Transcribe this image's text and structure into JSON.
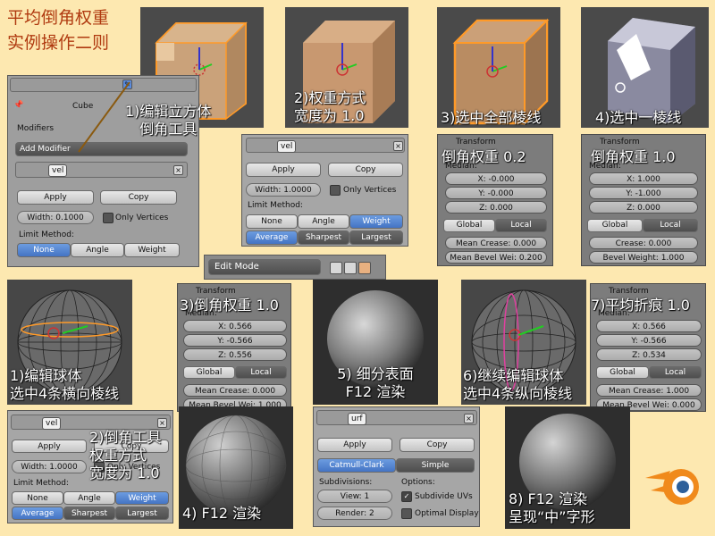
{
  "title": {
    "line1": "平均倒角权重",
    "line2": "实例操作二则"
  },
  "captions": {
    "c1": "1)编辑立方体",
    "c1b": "倒角工具",
    "c2": "2)权重方式",
    "c2b": "宽度为 1.0",
    "c3": "3)选中全部棱线",
    "c4": "4)选中一棱线",
    "w02": "倒角权重 0.2",
    "w10": "倒角权重 1.0",
    "s1": "1)编辑球体",
    "s1b": "选中4条横向棱线",
    "s3": "3)倒角权重 1.0",
    "s5": "5) 细分表面",
    "s5b": "F12 渲染",
    "s6": "6)继续编辑球体",
    "s6b": "选中4条纵向棱线",
    "s7": "7)平均折痕 1.0",
    "s2": "2)倒角工具",
    "s2b": "权重方式",
    "s2c": "宽度为 1.0",
    "s4": "4)  F12 渲染",
    "s8": "8)  F12 渲染",
    "s8b": "呈现“中”字形"
  },
  "modifiers_panel": {
    "object_name": "Cube",
    "section": "Modifiers",
    "add_modifier": "Add Modifier",
    "mod_name": "vel",
    "apply": "Apply",
    "copy": "Copy",
    "width": "Width: 0.1000",
    "only_vertices": "Only Vertices",
    "limit_method": "Limit Method:",
    "none": "None",
    "angle": "Angle",
    "weight": "Weight"
  },
  "weight_panel": {
    "mod_name": "vel",
    "apply": "Apply",
    "copy": "Copy",
    "width": "Width: 1.0000",
    "only_vertices": "Only Vertices",
    "limit_method": "Limit Method:",
    "none": "None",
    "angle": "Angle",
    "weight": "Weight",
    "average": "Average",
    "sharpest": "Sharpest",
    "largest": "Largest"
  },
  "mode": {
    "label": "Edit Mode"
  },
  "transform_a": {
    "header": "Transform",
    "median": "Median:",
    "x": "X: -0.000",
    "y": "Y: -0.000",
    "z": "Z: 0.000",
    "global": "Global",
    "local": "Local",
    "crease": "Mean Crease: 0.000",
    "bevel": "Mean Bevel Wei: 0.200"
  },
  "transform_b": {
    "header": "Transform",
    "median": "Median:",
    "x": "X: 1.000",
    "y": "Y: -1.000",
    "z": "Z: 0.000",
    "global": "Global",
    "local": "Local",
    "crease": "Crease: 0.000",
    "bevel": "Bevel Weight: 1.000"
  },
  "transform_c": {
    "header": "Transform",
    "median": "Median:",
    "x": "X: 0.566",
    "y": "Y: -0.566",
    "z": "Z: 0.556",
    "global": "Global",
    "local": "Local",
    "crease": "Mean Crease: 0.000",
    "bevel": "Mean Bevel Wei: 1.000"
  },
  "transform_d": {
    "header": "Transform",
    "median": "Median:",
    "x": "X: 0.566",
    "y": "Y: -0.566",
    "z": "Z: 0.534",
    "global": "Global",
    "local": "Local",
    "crease": "Mean Crease: 1.000",
    "bevel": "Mean Bevel Wei: 0.000"
  },
  "bevel_panel2": {
    "mod_name": "vel",
    "apply": "Apply",
    "copy": "Copy",
    "width": "Width: 1.0000",
    "only_vertices": "Only Vertices",
    "limit_method": "Limit Method:",
    "none": "None",
    "angle": "Angle",
    "weight": "Weight",
    "average": "Average",
    "sharpest": "Sharpest",
    "largest": "Largest"
  },
  "subsurf_panel": {
    "mod_name": "urf",
    "apply": "Apply",
    "copy": "Copy",
    "catmull": "Catmull-Clark",
    "simple": "Simple",
    "subdivisions": "Subdivisions:",
    "options": "Options:",
    "view": "View: 1",
    "render": "Render: 2",
    "subdivide_uvs": "Subdivide UVs",
    "optimal_display": "Optimal Display"
  }
}
